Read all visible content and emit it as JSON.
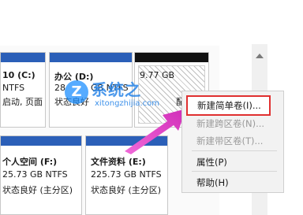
{
  "volumes": {
    "c": {
      "label": "10 (C:)",
      "fs": "NTFS",
      "status": "启动, 页面"
    },
    "d": {
      "label": "办公  (D:)",
      "size": "28",
      "fs": "GB NTFS",
      "status": "状态良好"
    },
    "unalloc": {
      "size": "9.77 GB",
      "status": "配"
    },
    "f": {
      "label": "个人空间  (F:)",
      "size": "25.73 GB NTFS",
      "status": "状态良好 (主分区)"
    },
    "e": {
      "label": "文件资料  (E:)",
      "size": "225.73 GB NTFS",
      "status": "状态良好 (主分区)"
    }
  },
  "context_menu": {
    "new_simple": "新建简单卷(I)...",
    "new_spanned": "新建跨区卷(N)...",
    "new_striped": "新建带区卷(T)...",
    "properties": "属性(P)",
    "help": "帮助(H)"
  },
  "watermark": {
    "logo": "Z",
    "title": "系统之",
    "url": "xitongzhijia.com"
  },
  "colors": {
    "volume_cap": "#2b5fb8",
    "highlight_border": "#e03030",
    "arrow": "#e040c8"
  }
}
